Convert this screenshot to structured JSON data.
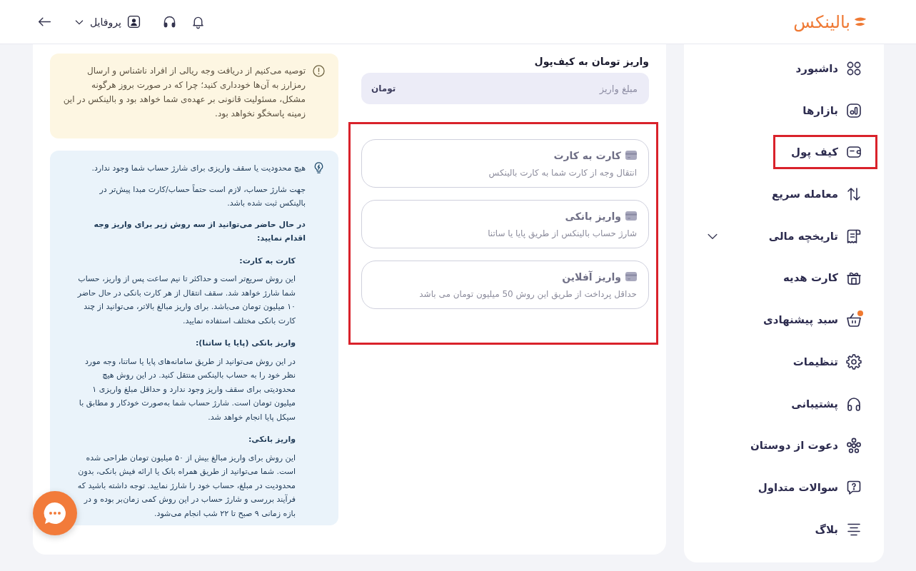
{
  "header": {
    "logo": "بالینکس",
    "profile": "پروفایل"
  },
  "sidebar": {
    "items": [
      {
        "label": "داشبورد",
        "kind": "link",
        "highlighted": false,
        "notification": false
      },
      {
        "label": "بازارها",
        "kind": "link",
        "highlighted": false,
        "notification": false
      },
      {
        "label": "کیف پول",
        "kind": "link",
        "highlighted": true,
        "notification": false
      },
      {
        "label": "معامله سریع",
        "kind": "link",
        "highlighted": false,
        "notification": false
      },
      {
        "label": "تاریخچه مالی",
        "kind": "group",
        "expanded": false,
        "highlighted": false,
        "notification": false
      },
      {
        "label": "کارت هدیه",
        "kind": "link",
        "highlighted": false,
        "notification": false
      },
      {
        "label": "سبد پیشنهادی",
        "kind": "link",
        "highlighted": false,
        "notification": true
      },
      {
        "label": "تنظیمات",
        "kind": "link",
        "highlighted": false,
        "notification": false
      },
      {
        "label": "پشتیبانی",
        "kind": "link",
        "highlighted": false,
        "notification": false
      },
      {
        "label": "دعوت از دوستان",
        "kind": "link",
        "highlighted": false,
        "notification": false
      },
      {
        "label": "سوالات متداول",
        "kind": "link",
        "highlighted": false,
        "notification": false
      },
      {
        "label": "بلاگ",
        "kind": "link",
        "highlighted": false,
        "notification": false
      }
    ]
  },
  "deposit": {
    "title": "واریز تومان به کیف‌پول",
    "amount_field": {
      "placeholder": "مبلغ واریز",
      "unit": "تومان"
    },
    "methods_highlighted": true,
    "methods": [
      {
        "title": "کارت به کارت",
        "description": "انتقال وجه از کارت شما به کارت بالینکس"
      },
      {
        "title": "واریز بانکی",
        "description": "شارژ حساب بالینکس از طریق پایا یا ساتنا"
      },
      {
        "title": "واریز آفلاین",
        "description": "حداقل پرداخت از طریق این روش 50 میلیون تومان می باشد"
      }
    ]
  },
  "warning": {
    "text": "توصیه می‌کنیم از دریافت وجه ریالی از افراد ناشناس و ارسال رمزارز به آن‌ها خودداری کنید؛ چرا که در صورت بروز هرگونه مشکل، مسئولیت قانونی بر عهده‌ی شما خواهد بود و بالینکس در این زمینه پاسخگو نخواهد بود."
  },
  "info": {
    "lead": "هیچ محدودیت یا سقف واریزی برای شارژ حساب شما وجود ندارد.",
    "note": "جهت شارژ حساب، لازم است حتماً حساب/کارت مبدا پیش‌تر در بالینکس ثبت شده باشد.",
    "intro": "در حال حاضر می‌توانید از سه روش زیر برای واریز وجه اقدام نمایید:",
    "sections": [
      {
        "heading": "کارت به کارت:",
        "text": "این روش سریع‌تر است و حداکثر تا نیم ساعت پس از واریز، حساب شما شارژ خواهد شد. سقف انتقال از هر کارت بانکی در حال حاضر ۱۰ میلیون تومان می‌باشد. برای واریز مبالغ بالاتر، می‌توانید از چند کارت بانکی مختلف استفاده نمایید."
      },
      {
        "heading": "واریز بانکی (پایا یا ساتنا):",
        "text": "در این روش می‌توانید از طریق سامانه‌های پایا یا ساتنا، وجه مورد نظر خود را به حساب بالینکس منتقل کنید. در این روش هیچ محدودیتی برای سقف واریز وجود ندارد و حداقل مبلغ واریزی ۱ میلیون تومان است. شارژ حساب شما به‌صورت خودکار و مطابق با سیکل پایا انجام خواهد شد."
      },
      {
        "heading": "واریز بانکی:",
        "text": "این روش برای واریز مبالغ بیش از ۵۰ میلیون تومان طراحی شده است. شما می‌توانید از طریق همراه بانک یا ارائه فیش بانکی، بدون محدودیت در مبلغ، حساب خود را شارژ نمایید. توجه داشته باشید که فرآیند بررسی و شارژ حساب در این روش کمی زمان‌بر بوده و در بازه زمانی ۹ صبح تا ۲۲ شب انجام می‌شود."
      }
    ]
  }
}
